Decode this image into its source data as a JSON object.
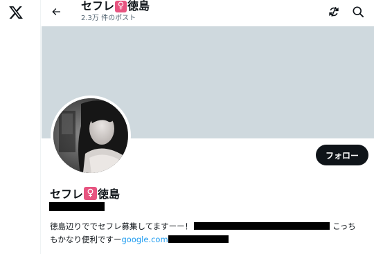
{
  "nav": {
    "logo_icon": "x-logo-icon"
  },
  "header": {
    "back_icon": "arrow-left-icon",
    "title_prefix": "セフレ",
    "title_badge": "♀",
    "title_suffix": "徳島",
    "post_count": "2.3万 件のポスト",
    "refresh_icon": "refresh-icon",
    "search_icon": "search-icon"
  },
  "profile": {
    "name_prefix": "セフレ",
    "name_badge": "♀",
    "name_suffix": "徳島",
    "follow_label": "フォロー",
    "bio_line1": "徳島辺りででセフレ募集してますーー！",
    "bio_line1_end": "こっち",
    "bio_line2": "もかなり便利ですー",
    "bio_link_fragment": "google.com"
  },
  "colors": {
    "banner": "#cfd9de",
    "badge": "#e75480",
    "follow_bg": "#0f1419",
    "link": "#1d9bf0"
  }
}
